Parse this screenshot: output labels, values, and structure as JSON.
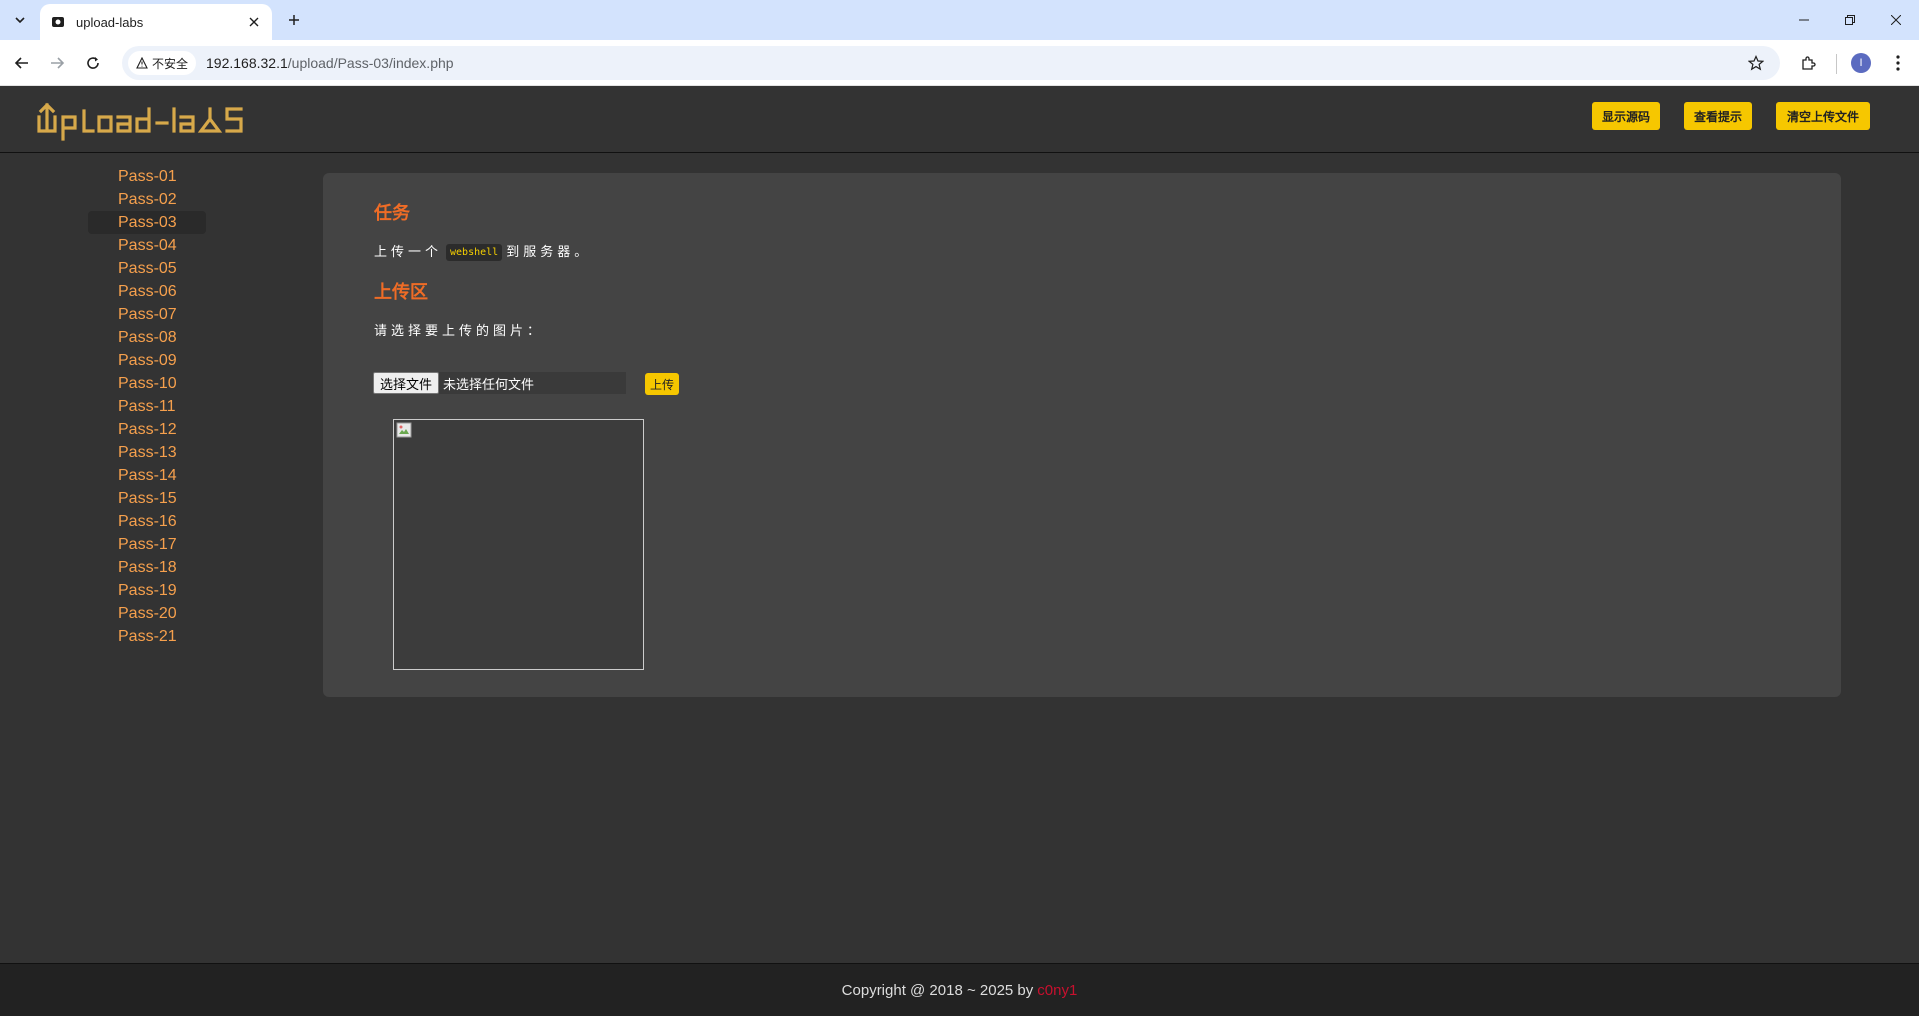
{
  "browser": {
    "tab_title": "upload-labs",
    "security_label": "不安全",
    "url_host": "192.168.32.1",
    "url_path": "/upload/Pass-03/index.php",
    "profile_initial": "I"
  },
  "header": {
    "logo_text": "upload-labs",
    "buttons": [
      "显示源码",
      "查看提示",
      "清空上传文件"
    ]
  },
  "sidebar": {
    "items": [
      "Pass-01",
      "Pass-02",
      "Pass-03",
      "Pass-04",
      "Pass-05",
      "Pass-06",
      "Pass-07",
      "Pass-08",
      "Pass-09",
      "Pass-10",
      "Pass-11",
      "Pass-12",
      "Pass-13",
      "Pass-14",
      "Pass-15",
      "Pass-16",
      "Pass-17",
      "Pass-18",
      "Pass-19",
      "Pass-20",
      "Pass-21"
    ],
    "active": "Pass-03"
  },
  "main": {
    "task_title": "任务",
    "task_pre": "上传一个",
    "task_code": "webshell",
    "task_post": "到服务器。",
    "upload_title": "上传区",
    "upload_prompt": "请选择要上传的图片：",
    "choose_file_label": "选择文件",
    "no_file_label": "未选择任何文件",
    "upload_button": "上传"
  },
  "footer": {
    "copyright": "Copyright @ 2018 ~ 2025 by",
    "author": "c0ny1"
  },
  "colors": {
    "accent_yellow": "#f6c700",
    "link_orange": "#f6a04d",
    "title_orange": "#ef6c26",
    "author_red": "#c8102e",
    "page_bg": "#333333",
    "panel_bg": "#444444"
  }
}
